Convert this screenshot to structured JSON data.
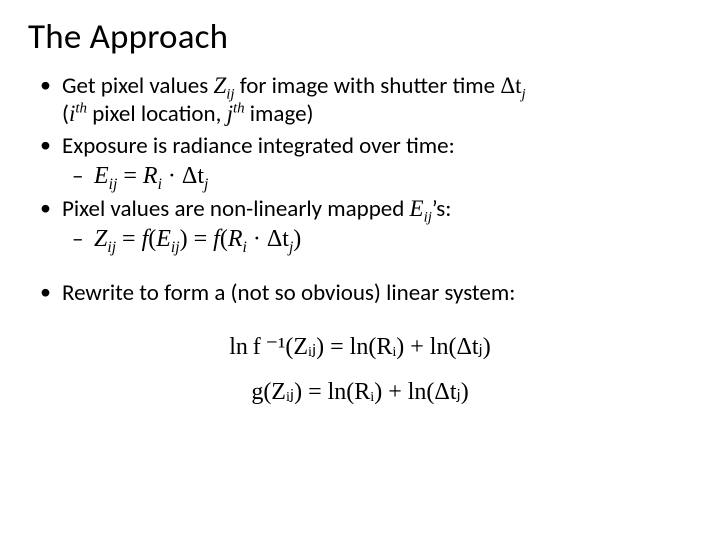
{
  "title": "The Approach",
  "bullets": {
    "b1_a": "Get pixel values ",
    "b1_Z": "Z",
    "b1_ij": "ij",
    "b1_b": " for image with shutter time ",
    "b1_dt": "Δt",
    "b1_j": "j",
    "b1_c": "(",
    "b1_i": "i",
    "b1_th1": "th",
    "b1_d": " pixel location, ",
    "b1_j2": "j",
    "b1_th2": "th",
    "b1_e": " image)",
    "b2": "Exposure is radiance integrated over time:",
    "eq1_E": "E",
    "eq1_ij": "ij",
    "eq1_eq": " = ",
    "eq1_R": "R",
    "eq1_i": "i",
    "eq1_dot": " · ",
    "eq1_dt": "Δt",
    "eq1_j": "j",
    "b3_a": "Pixel values are non-linearly mapped ",
    "b3_E": "E",
    "b3_ij": "ij",
    "b3_b": "’s:",
    "eq2_Z": "Z",
    "eq2_ij": "ij",
    "eq2_eq": " = ",
    "eq2_f": "f",
    "eq2_lp": "(",
    "eq2_E": "E",
    "eq2_Eij": "ij",
    "eq2_rp": ")",
    "eq2_eq2": " = ",
    "eq2_f2": "f",
    "eq2_lp2": "(",
    "eq2_R": "R",
    "eq2_Ri": "i",
    "eq2_dot": " · ",
    "eq2_dt": "Δt",
    "eq2_dtj": "j",
    "eq2_rp2": ")",
    "b4": "Rewrite to form a (not so obvious) linear system:"
  },
  "equations": {
    "line1": "ln f ⁻¹(Zᵢⱼ) = ln(Rᵢ) + ln(Δtⱼ)",
    "line2": "g(Zᵢⱼ) = ln(Rᵢ) + ln(Δtⱼ)"
  }
}
